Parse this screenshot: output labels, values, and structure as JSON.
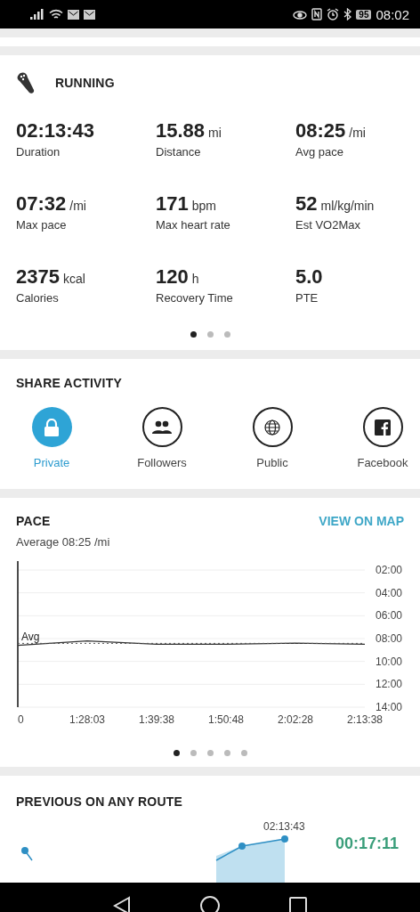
{
  "status_bar": {
    "battery": "95",
    "time": "08:02"
  },
  "activity": {
    "title": "RUNNING",
    "stats": [
      {
        "value": "02:13:43",
        "label": "Duration"
      },
      {
        "value": "15.88",
        "unit": "mi",
        "label": "Distance"
      },
      {
        "value": "08:25",
        "unit": "/mi",
        "label": "Avg pace"
      },
      {
        "value": "07:32",
        "unit": "/mi",
        "label": "Max pace"
      },
      {
        "value": "171",
        "unit": "bpm",
        "label": "Max heart rate"
      },
      {
        "value": "52",
        "unit": "ml/kg/min",
        "label": "Est VO2Max"
      },
      {
        "value": "2375",
        "unit": "kcal",
        "label": "Calories"
      },
      {
        "value": "120",
        "unit": "h",
        "label": "Recovery Time"
      },
      {
        "value": "5.0",
        "label": "PTE"
      }
    ],
    "pages": [
      {
        "selected": true
      },
      {
        "selected": false
      },
      {
        "selected": false
      }
    ]
  },
  "share": {
    "title": "SHARE ACTIVITY",
    "options": [
      {
        "kind": "lock",
        "label": "Private",
        "selected": true
      },
      {
        "kind": "people",
        "label": "Followers",
        "selected": false
      },
      {
        "kind": "globe",
        "label": "Public",
        "selected": false
      },
      {
        "kind": "facebook",
        "label": "Facebook",
        "selected": false
      }
    ]
  },
  "pace": {
    "title": "PACE",
    "link": "VIEW ON MAP",
    "subtitle": "Average 08:25 /mi",
    "chart_data": {
      "type": "line",
      "categories": [
        "0",
        "1:28:03",
        "1:39:38",
        "1:50:48",
        "2:02:28",
        "2:13:38"
      ],
      "series": [
        {
          "color": "#333333",
          "values": [
            8.6,
            8.2,
            8.5,
            8.5,
            8.4,
            8.5
          ]
        },
        {
          "name": "Avg",
          "color": "#555555",
          "line_style": "dashed",
          "values": [
            8.42,
            8.42,
            8.42,
            8.42,
            8.42,
            8.42
          ]
        }
      ],
      "ylim": [
        14,
        2
      ],
      "yticks": [
        {
          "value": 2,
          "label": "02:00"
        },
        {
          "value": 4,
          "label": "04:00"
        },
        {
          "value": 6,
          "label": "06:00"
        },
        {
          "value": 8,
          "label": "08:00"
        },
        {
          "value": 10,
          "label": "10:00"
        },
        {
          "value": 12,
          "label": "12:00"
        },
        {
          "value": 14,
          "label": "14:00"
        }
      ],
      "grid": true
    },
    "pages": [
      {
        "selected": true
      },
      {
        "selected": false
      },
      {
        "selected": false
      },
      {
        "selected": false
      },
      {
        "selected": false
      }
    ]
  },
  "previous": {
    "title": "PREVIOUS ON ANY ROUTE",
    "point_label": "02:13:43",
    "difference": "00:17:11"
  }
}
